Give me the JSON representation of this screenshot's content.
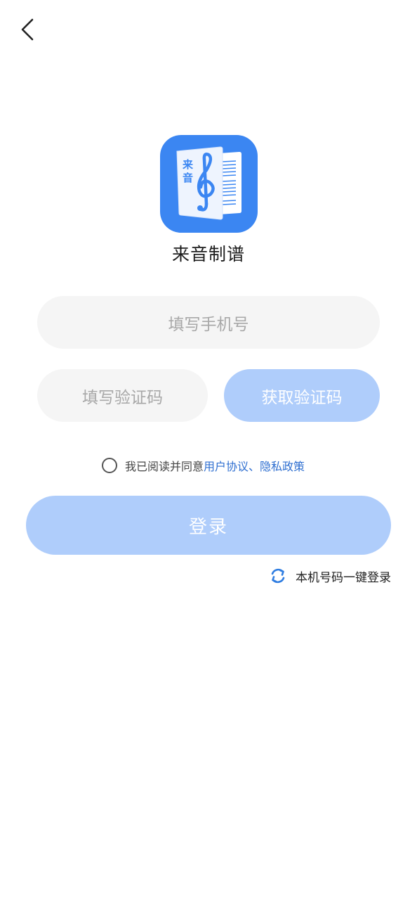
{
  "header": {
    "back_icon": "chevron-left-icon"
  },
  "app": {
    "icon": "app-logo-icon",
    "icon_text_line1": "来",
    "icon_text_line2": "音",
    "name": "来音制谱",
    "brand_color": "#3b86f2"
  },
  "form": {
    "phone_placeholder": "填写手机号",
    "code_placeholder": "填写验证码",
    "get_code_label": "获取验证码"
  },
  "agreement": {
    "prefix": "我已阅读并同意",
    "user_agreement": "用户协议",
    "separator": "、",
    "privacy_policy": "隐私政策",
    "checked": false,
    "link_color": "#2f6fd0"
  },
  "login": {
    "label": "登录",
    "button_color": "#afcdfb"
  },
  "one_key": {
    "icon": "refresh-icon",
    "label": "本机号码一键登录"
  }
}
